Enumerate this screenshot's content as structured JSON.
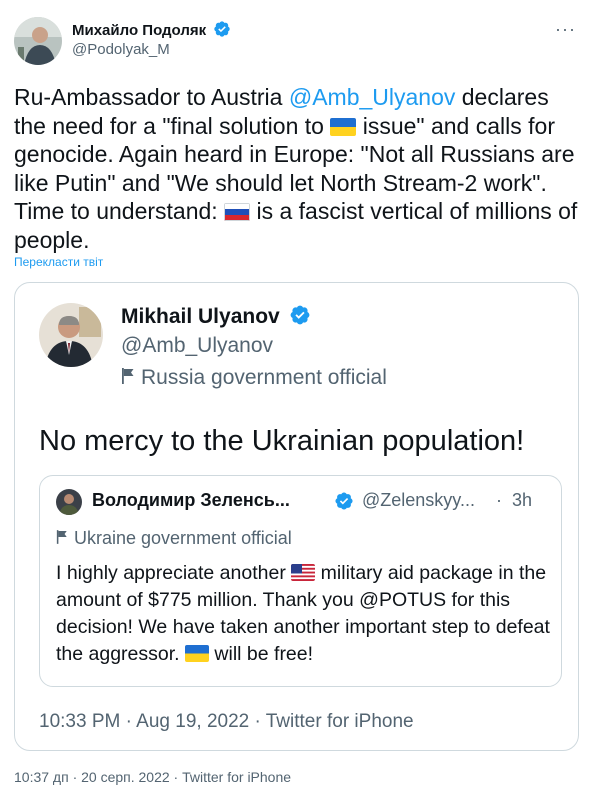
{
  "tweet": {
    "author_name": "Михайло Подоляк",
    "author_handle": "@Podolyak_M",
    "more_label": "···",
    "text_parts": {
      "p1": "Ru-Ambassador to Austria ",
      "mention": "@Amb_Ulyanov",
      "p2": " declares the need for a \"final solution to ",
      "p3": " issue\" and calls for genocide. Again heard in Europe: \"Not all Russians are like Putin\" and \"We should let North Stream-2 work\". Time to understand: ",
      "p4": " is a fascist vertical of millions of people."
    },
    "translate_label": "Перекласти твіт",
    "footer": "10:37 дп · 20 серп. 2022 · Twitter for iPhone"
  },
  "quoted": {
    "name": "Mikhail Ulyanov",
    "handle": "@Amb_Ulyanov",
    "label": "Russia government official",
    "text": "No mercy to the Ukrainian population!",
    "footer": "10:33 PM · Aug 19, 2022 · Twitter for iPhone",
    "inner": {
      "name": "Володимир Зеленсь...",
      "handle": "@Zelenskyy...",
      "dot": "·",
      "time": "3h",
      "label": "Ukraine government official",
      "text_parts": {
        "p1": "I highly appreciate another ",
        "p2": " military aid package in the amount of $775 million. Thank you @POTUS for this decision! We have taken another important step to defeat the aggressor. ",
        "p3": " will be free!"
      }
    }
  },
  "colors": {
    "accent": "#1d9bf0",
    "secondary_text": "#536471",
    "border": "#cfd9de"
  },
  "icons": [
    "verified-badge-icon",
    "more-icon",
    "government-flag-icon",
    "ukraine-flag-emoji",
    "russia-flag-emoji",
    "usa-flag-emoji"
  ]
}
